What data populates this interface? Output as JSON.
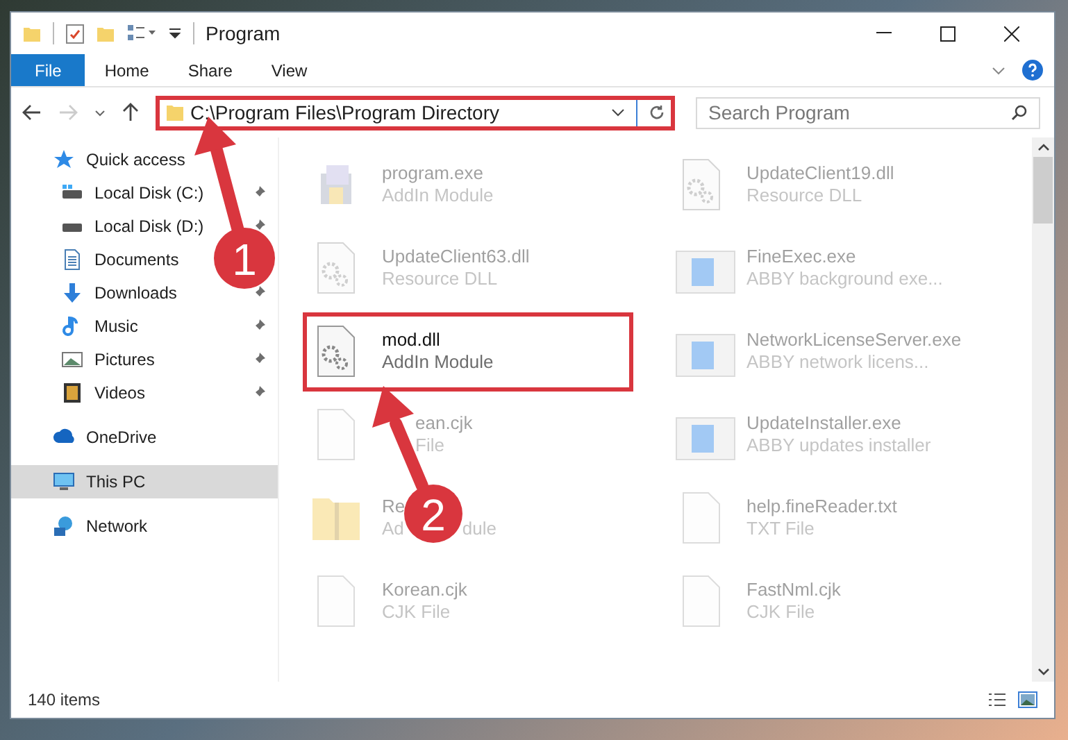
{
  "window": {
    "title": "Program"
  },
  "ribbon": {
    "tabs": [
      {
        "label": "File",
        "kind": "file"
      },
      {
        "label": "Home",
        "kind": "tab"
      },
      {
        "label": "Share",
        "kind": "tab"
      },
      {
        "label": "View",
        "kind": "tab"
      }
    ]
  },
  "address_bar": {
    "path": "C:\\Program Files\\Program Directory",
    "highlighted": true
  },
  "search": {
    "placeholder": "Search Program"
  },
  "sidebar": {
    "items": [
      {
        "label": "Quick access",
        "selected": false,
        "children": [
          {
            "label": "Local Disk (C:)",
            "pinned": true
          },
          {
            "label": "Local Disk (D:)",
            "pinned": true
          },
          {
            "label": "Documents",
            "pinned": false
          },
          {
            "label": "Downloads",
            "pinned": true
          },
          {
            "label": "Music",
            "pinned": true
          },
          {
            "label": "Pictures",
            "pinned": true
          },
          {
            "label": "Videos",
            "pinned": true
          }
        ]
      },
      {
        "label": "OneDrive",
        "selected": false
      },
      {
        "label": "This PC",
        "selected": true
      },
      {
        "label": "Network",
        "selected": false
      }
    ]
  },
  "files": [
    {
      "name": "program.exe",
      "type": "AddIn Module",
      "kind": "installer",
      "dimmed": true,
      "highlighted": false
    },
    {
      "name": "UpdateClient19.dll",
      "type": "Resource DLL",
      "kind": "dll",
      "dimmed": true,
      "highlighted": false
    },
    {
      "name": "UpdateClient63.dll",
      "type": "Resource DLL",
      "kind": "dll",
      "dimmed": true,
      "highlighted": false
    },
    {
      "name": "FineExec.exe",
      "type": "ABBY background exe...",
      "kind": "app",
      "dimmed": true,
      "highlighted": false
    },
    {
      "name": "mod.dll",
      "type": "AddIn Module",
      "kind": "dll",
      "dimmed": false,
      "highlighted": true
    },
    {
      "name": "NetworkLicenseServer.exe",
      "type": "ABBY network licens...",
      "kind": "app",
      "dimmed": true,
      "highlighted": false
    },
    {
      "name": "ean.cjk",
      "type": "File",
      "kind": "document",
      "dimmed": true,
      "highlighted": false,
      "covered_start": true
    },
    {
      "name": "UpdateInstaller.exe",
      "type": "ABBY updates installer",
      "kind": "app",
      "dimmed": true,
      "highlighted": false
    },
    {
      "name": "Re",
      "type": "Ad",
      "type_after_cover": "dule",
      "kind": "archive",
      "dimmed": true,
      "highlighted": false
    },
    {
      "name": "help.fineReader.txt",
      "type": "TXT File",
      "kind": "document",
      "dimmed": true,
      "highlighted": false
    },
    {
      "name": "Korean.cjk",
      "type": "CJK File",
      "kind": "document",
      "dimmed": true,
      "highlighted": false
    },
    {
      "name": "FastNml.cjk",
      "type": "CJK File",
      "kind": "document",
      "dimmed": true,
      "highlighted": false
    }
  ],
  "status_bar": {
    "item_count": "140 items"
  },
  "annotations": [
    {
      "number": "1"
    },
    {
      "number": "2"
    }
  ]
}
